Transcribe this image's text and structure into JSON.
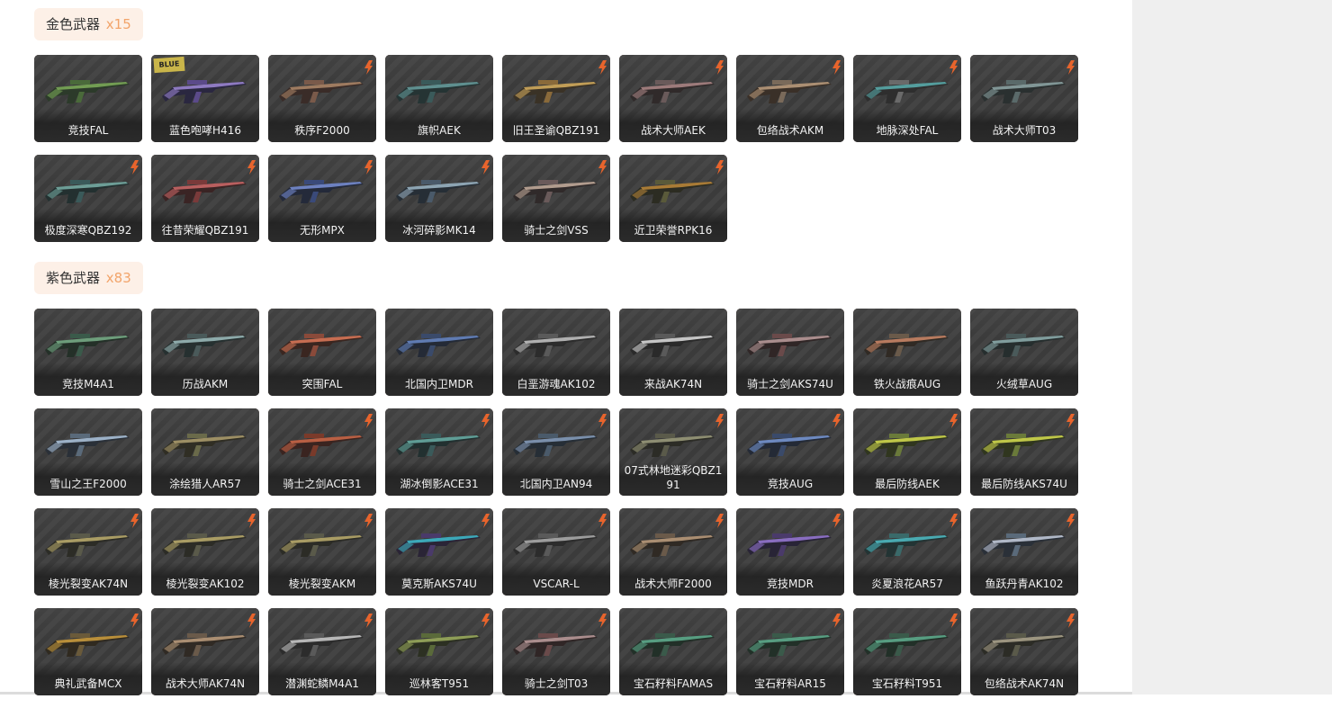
{
  "sections": [
    {
      "title": "金色武器",
      "count": "x15",
      "items": [
        {
          "name": "竞技FAL",
          "palette": [
            "#4a6a3a",
            "#2c3a2a",
            "#7fae5a"
          ],
          "tag": false
        },
        {
          "name": "蓝色咆哮H416",
          "palette": [
            "#5b4a8a",
            "#2a2740",
            "#a08ad8"
          ],
          "tag": false,
          "badge": "BLUE"
        },
        {
          "name": "秩序F2000",
          "palette": [
            "#7a5a4a",
            "#3a2c28",
            "#b08a6a"
          ],
          "tag": true
        },
        {
          "name": "旗帜AEK",
          "palette": [
            "#3a5a5a",
            "#253434",
            "#6aa0a0"
          ],
          "tag": false
        },
        {
          "name": "旧王圣谕QBZ191",
          "palette": [
            "#8a6a3a",
            "#3a3226",
            "#d8b060"
          ],
          "tag": true
        },
        {
          "name": "战术大师AEK",
          "palette": [
            "#6a5a5a",
            "#302a2a",
            "#b08a8a"
          ],
          "tag": true
        },
        {
          "name": "包络战术AKM",
          "palette": [
            "#7a6a5a",
            "#3a3028",
            "#c0a080"
          ],
          "tag": true
        },
        {
          "name": "地脉深处FAL",
          "palette": [
            "#6a6a6a",
            "#2e2e2e",
            "#5ab0b0"
          ],
          "tag": true
        },
        {
          "name": "战术大师T03",
          "palette": [
            "#5a6a6a",
            "#2a3030",
            "#90a8a8"
          ],
          "tag": true
        },
        {
          "name": "极度深寒QBZ192",
          "palette": [
            "#3a5a5a",
            "#233030",
            "#7ab0a8"
          ],
          "tag": true
        },
        {
          "name": "往昔荣耀QBZ191",
          "palette": [
            "#7a3a3a",
            "#3a2424",
            "#d06a6a"
          ],
          "tag": true
        },
        {
          "name": "无形MPX",
          "palette": [
            "#3a4a7a",
            "#242a3a",
            "#7a90d8"
          ],
          "tag": true
        },
        {
          "name": "冰河碎影MK14",
          "palette": [
            "#4a5a6a",
            "#262e36",
            "#a0b8c8"
          ],
          "tag": true
        },
        {
          "name": "骑士之剑VSS",
          "palette": [
            "#6a5a5a",
            "#302a2a",
            "#c8b0a0"
          ],
          "tag": true
        },
        {
          "name": "近卫荣誉RPK16",
          "palette": [
            "#5a5a3a",
            "#2c2c22",
            "#c08a3a"
          ],
          "tag": true
        }
      ]
    },
    {
      "title": "紫色武器",
      "count": "x83",
      "items": [
        {
          "name": "竞技M4A1",
          "palette": [
            "#3a5a4a",
            "#243028",
            "#7ab08a"
          ],
          "tag": false
        },
        {
          "name": "历战AKM",
          "palette": [
            "#4a5a5a",
            "#263030",
            "#a0c0c0"
          ],
          "tag": false
        },
        {
          "name": "突围FAL",
          "palette": [
            "#8a4a3a",
            "#3a2620",
            "#e07a5a"
          ],
          "tag": false
        },
        {
          "name": "北国内卫MDR",
          "palette": [
            "#3a4a6a",
            "#242a36",
            "#6a8ac8"
          ],
          "tag": false
        },
        {
          "name": "白垩游魂AK102",
          "palette": [
            "#5a5a5a",
            "#2c2c2c",
            "#c8c8c8"
          ],
          "tag": false
        },
        {
          "name": "来战AK74N",
          "palette": [
            "#5a5a5a",
            "#2a2a2a",
            "#e0e0e0"
          ],
          "tag": false
        },
        {
          "name": "骑士之剑AKS74U",
          "palette": [
            "#6a4a4a",
            "#302626",
            "#c0a0a0"
          ],
          "tag": false
        },
        {
          "name": "铁火战痕AUG",
          "palette": [
            "#6a5a4a",
            "#302a24",
            "#d08a6a"
          ],
          "tag": false
        },
        {
          "name": "火绒草AUG",
          "palette": [
            "#4a5a5a",
            "#262e2e",
            "#90b0b0"
          ],
          "tag": false
        },
        {
          "name": "雪山之王F2000",
          "palette": [
            "#5a6a7a",
            "#2a3038",
            "#b0c8e0"
          ],
          "tag": false
        },
        {
          "name": "涂绘猎人AR57",
          "palette": [
            "#6a6a4a",
            "#302e24",
            "#b0a070"
          ],
          "tag": false
        },
        {
          "name": "骑士之剑ACE31",
          "palette": [
            "#7a3a2a",
            "#3a2420",
            "#d06a4a"
          ],
          "tag": true
        },
        {
          "name": "湖冰倒影ACE31",
          "palette": [
            "#3a5a5a",
            "#223030",
            "#6ab0a8"
          ],
          "tag": true
        },
        {
          "name": "北国内卫AN94",
          "palette": [
            "#4a5a6a",
            "#262e36",
            "#8aa0c0"
          ],
          "tag": true
        },
        {
          "name": "07式林地迷彩QBZ191",
          "palette": [
            "#5a5a4a",
            "#2c2c26",
            "#a0a080"
          ],
          "tag": true
        },
        {
          "name": "竞技AUG",
          "palette": [
            "#3a4a6a",
            "#242a36",
            "#7a9ad8"
          ],
          "tag": true
        },
        {
          "name": "最后防线AEK",
          "palette": [
            "#6a7a3a",
            "#30361f",
            "#d8e050"
          ],
          "tag": true
        },
        {
          "name": "最后防线AKS74U",
          "palette": [
            "#6a7a3a",
            "#30361f",
            "#d8e050"
          ],
          "tag": true
        },
        {
          "name": "棱光裂变AK74N",
          "palette": [
            "#5a5a4a",
            "#2c2c26",
            "#c0b070"
          ],
          "tag": true
        },
        {
          "name": "棱光裂变AK102",
          "palette": [
            "#5a5a4a",
            "#2c2c26",
            "#c0b070"
          ],
          "tag": true
        },
        {
          "name": "棱光裂变AKM",
          "palette": [
            "#5a5a4a",
            "#2c2c26",
            "#c0b070"
          ],
          "tag": true
        },
        {
          "name": "莫克斯AKS74U",
          "palette": [
            "#4a3a6a",
            "#2a2436",
            "#40c0d0"
          ],
          "tag": true
        },
        {
          "name": "VSCAR-L",
          "palette": [
            "#5a5a5a",
            "#2c2c2c",
            "#b0b0b0"
          ],
          "tag": true
        },
        {
          "name": "战术大师F2000",
          "palette": [
            "#6a5a4a",
            "#302a24",
            "#c0a080"
          ],
          "tag": true
        },
        {
          "name": "竞技MDR",
          "palette": [
            "#4a3a6a",
            "#282436",
            "#9a7ad8"
          ],
          "tag": true
        },
        {
          "name": "炎夏浪花AR57",
          "palette": [
            "#3a6a6a",
            "#233434",
            "#50c0c8"
          ],
          "tag": true
        },
        {
          "name": "鱼跃丹青AK102",
          "palette": [
            "#5a6a7a",
            "#2a3038",
            "#c8d0e0"
          ],
          "tag": true
        },
        {
          "name": "典礼武备MCX",
          "palette": [
            "#6a5a3a",
            "#302a20",
            "#d0a040"
          ],
          "tag": true
        },
        {
          "name": "战术大师AK74N",
          "palette": [
            "#6a5a4a",
            "#302a24",
            "#c0a080"
          ],
          "tag": true
        },
        {
          "name": "潜渊蛇鳞M4A1",
          "palette": [
            "#5a5a5a",
            "#2c2c2c",
            "#d0d0d0"
          ],
          "tag": true
        },
        {
          "name": "巡林客T951",
          "palette": [
            "#5a6a3a",
            "#2c3022",
            "#a0b060"
          ],
          "tag": true
        },
        {
          "name": "骑士之剑T03",
          "palette": [
            "#6a4a4a",
            "#302626",
            "#c0a0a0"
          ],
          "tag": true
        },
        {
          "name": "宝石籽料FAMAS",
          "palette": [
            "#3a5a4a",
            "#223028",
            "#60b090"
          ],
          "tag": false
        },
        {
          "name": "宝石籽料AR15",
          "palette": [
            "#3a5a4a",
            "#223028",
            "#60b090"
          ],
          "tag": true
        },
        {
          "name": "宝石籽料T951",
          "palette": [
            "#3a5a4a",
            "#223028",
            "#60b090"
          ],
          "tag": true
        },
        {
          "name": "包络战术AK74N",
          "palette": [
            "#5a5a4a",
            "#2c2c26",
            "#b0a890"
          ],
          "tag": true
        }
      ]
    }
  ],
  "colors": {
    "header_bg": "#fdf0e7",
    "count_text": "#f2a46a",
    "card_label": "#f2f2f2",
    "tag_orange": "#e8642c"
  }
}
